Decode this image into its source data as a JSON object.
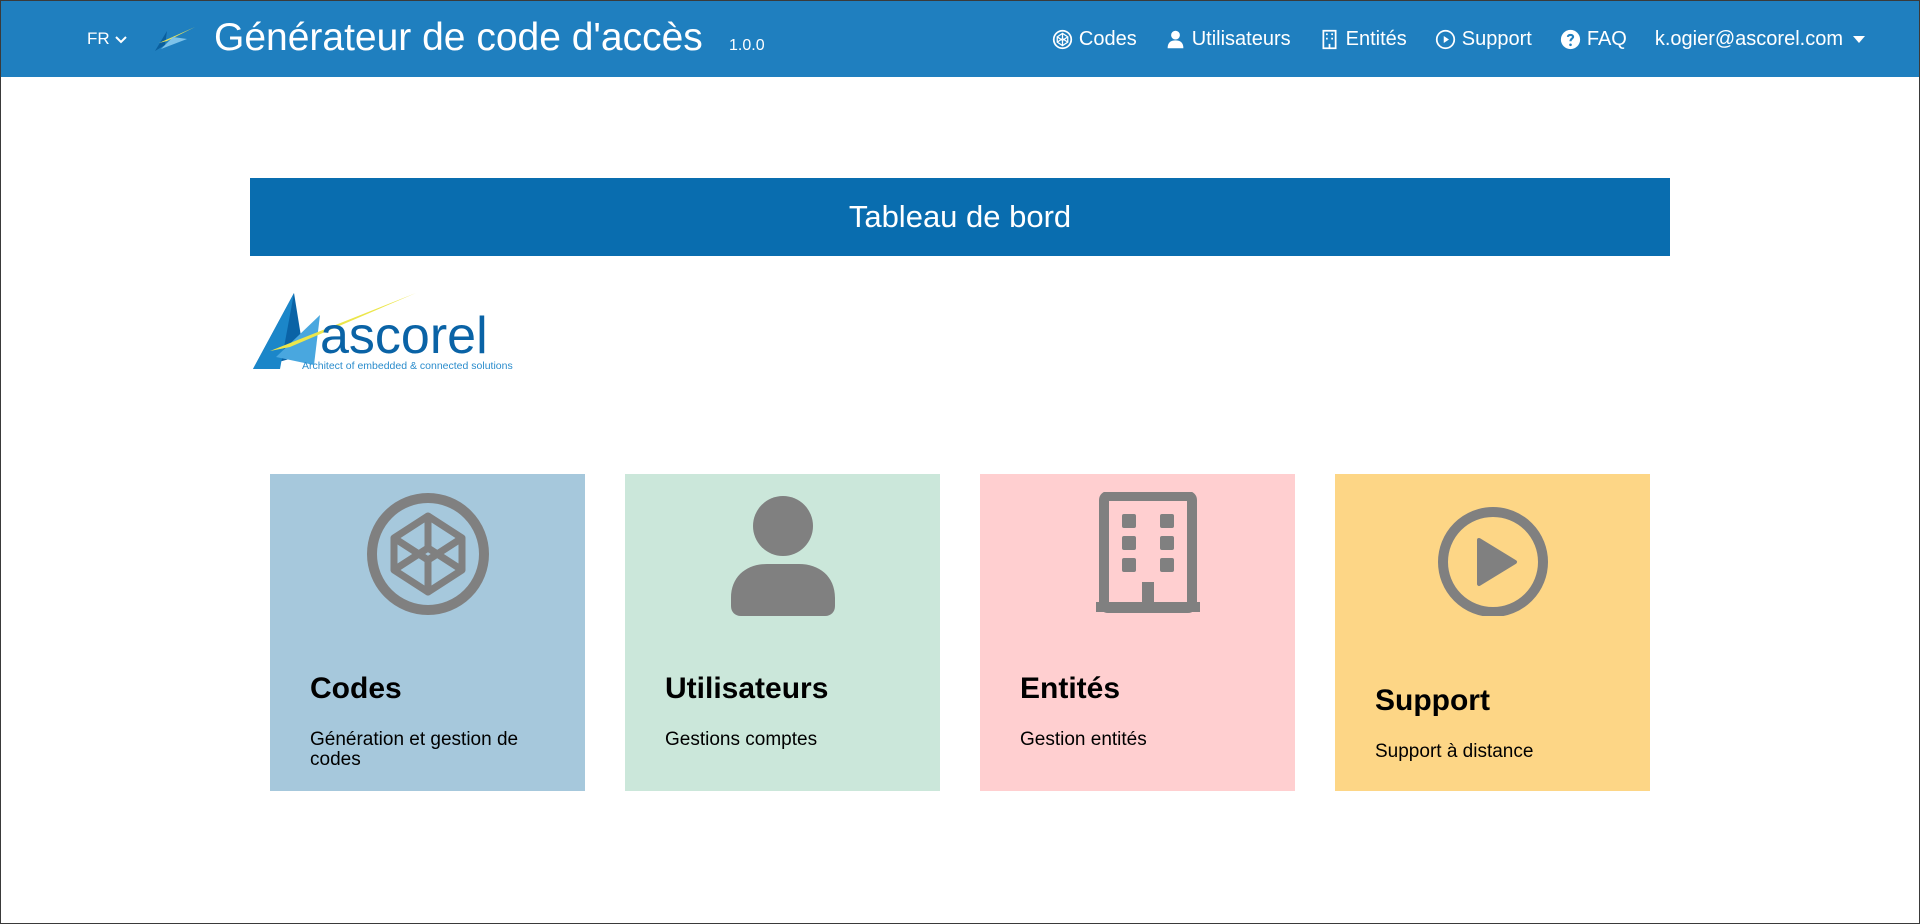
{
  "navbar": {
    "language": "FR",
    "app_title": "Générateur de code d'accès",
    "app_version": "1.0.0",
    "menu": {
      "codes": "Codes",
      "users": "Utilisateurs",
      "entities": "Entités",
      "support": "Support",
      "faq": "FAQ",
      "account": "k.ogier@ascorel.com"
    },
    "color": "#1f7fbf"
  },
  "dashboard": {
    "title": "Tableau de bord",
    "header_color": "#096daf"
  },
  "logo": {
    "name": "ascorel",
    "tagline": "Architect of embedded & connected solutions"
  },
  "cards": [
    {
      "title": "Codes",
      "description": "Génération et gestion de codes",
      "color": "#a6c8dc",
      "icon": "codepen-icon"
    },
    {
      "title": "Utilisateurs",
      "description": "Gestions comptes",
      "color": "#cbe7da",
      "icon": "user-icon"
    },
    {
      "title": "Entités",
      "description": "Gestion entités",
      "color": "#ffcfd0",
      "icon": "building-icon"
    },
    {
      "title": "Support",
      "description": "Support à distance",
      "color": "#fdd686",
      "icon": "play-circle-icon"
    }
  ]
}
